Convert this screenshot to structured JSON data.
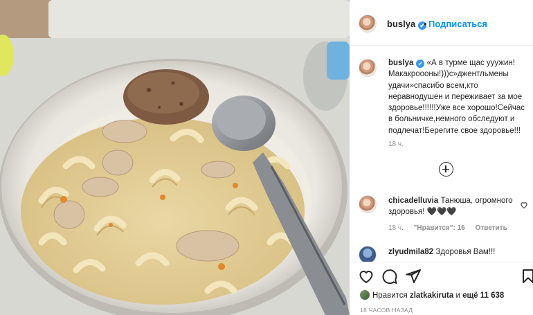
{
  "header": {
    "username": "buslya",
    "verified": "✔",
    "separator": "•",
    "follow_label": "Подписаться"
  },
  "caption": {
    "username": "buslya",
    "verified": "✔",
    "text": "«А в турме щас ууужин! Макакроооны!)))с»джентльмены удачи»спасибо всем,кто неравнодушен и переживает за мое здоровье!!!!!!Уже все хорошо!Сейчас в больничке,немного обследуют и подлечат!Берегите свое здоровье!!!",
    "time": "18 ч."
  },
  "comments": [
    {
      "username": "chicadelluvia",
      "text": "Танюша, огромного здоровья! 🖤🖤🖤",
      "time": "18 ч.",
      "likes": "\"Нравится\": 16",
      "reply": "Ответить"
    },
    {
      "username": "zlyudmila82",
      "text": "Здоровья Вам!!!"
    }
  ],
  "footer": {
    "likes_prefix": "Нравится",
    "likes_user": "zlatkakiruta",
    "likes_and": "и",
    "likes_count": "ещё 11 638",
    "post_time": "18 ЧАСОВ НАЗАД"
  },
  "icons": {
    "like": "heart-icon",
    "comment": "comment-icon",
    "share": "paper-plane-icon",
    "save": "bookmark-icon",
    "load_more": "plus-circle-icon"
  },
  "colors": {
    "accent": "#0095f6",
    "verified": "#3897f0",
    "muted": "#8e8e8e"
  }
}
